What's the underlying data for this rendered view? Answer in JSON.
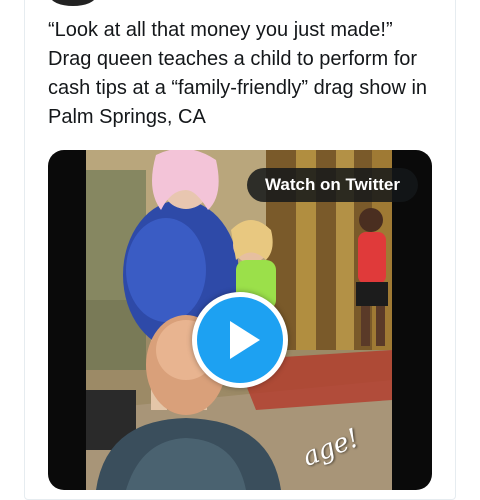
{
  "tweet": {
    "text": "“Look at all that money you just made!” Drag queen teaches a child to perform for cash tips at a “family-friendly” drag show in Palm Springs, CA"
  },
  "media": {
    "watch_label": "Watch on Twitter",
    "play_icon": "play-icon",
    "overlay_text": "age!"
  },
  "colors": {
    "accent": "#1da1f2",
    "text": "#14171a",
    "border": "#e6ecf0",
    "pill": "#14171a"
  }
}
